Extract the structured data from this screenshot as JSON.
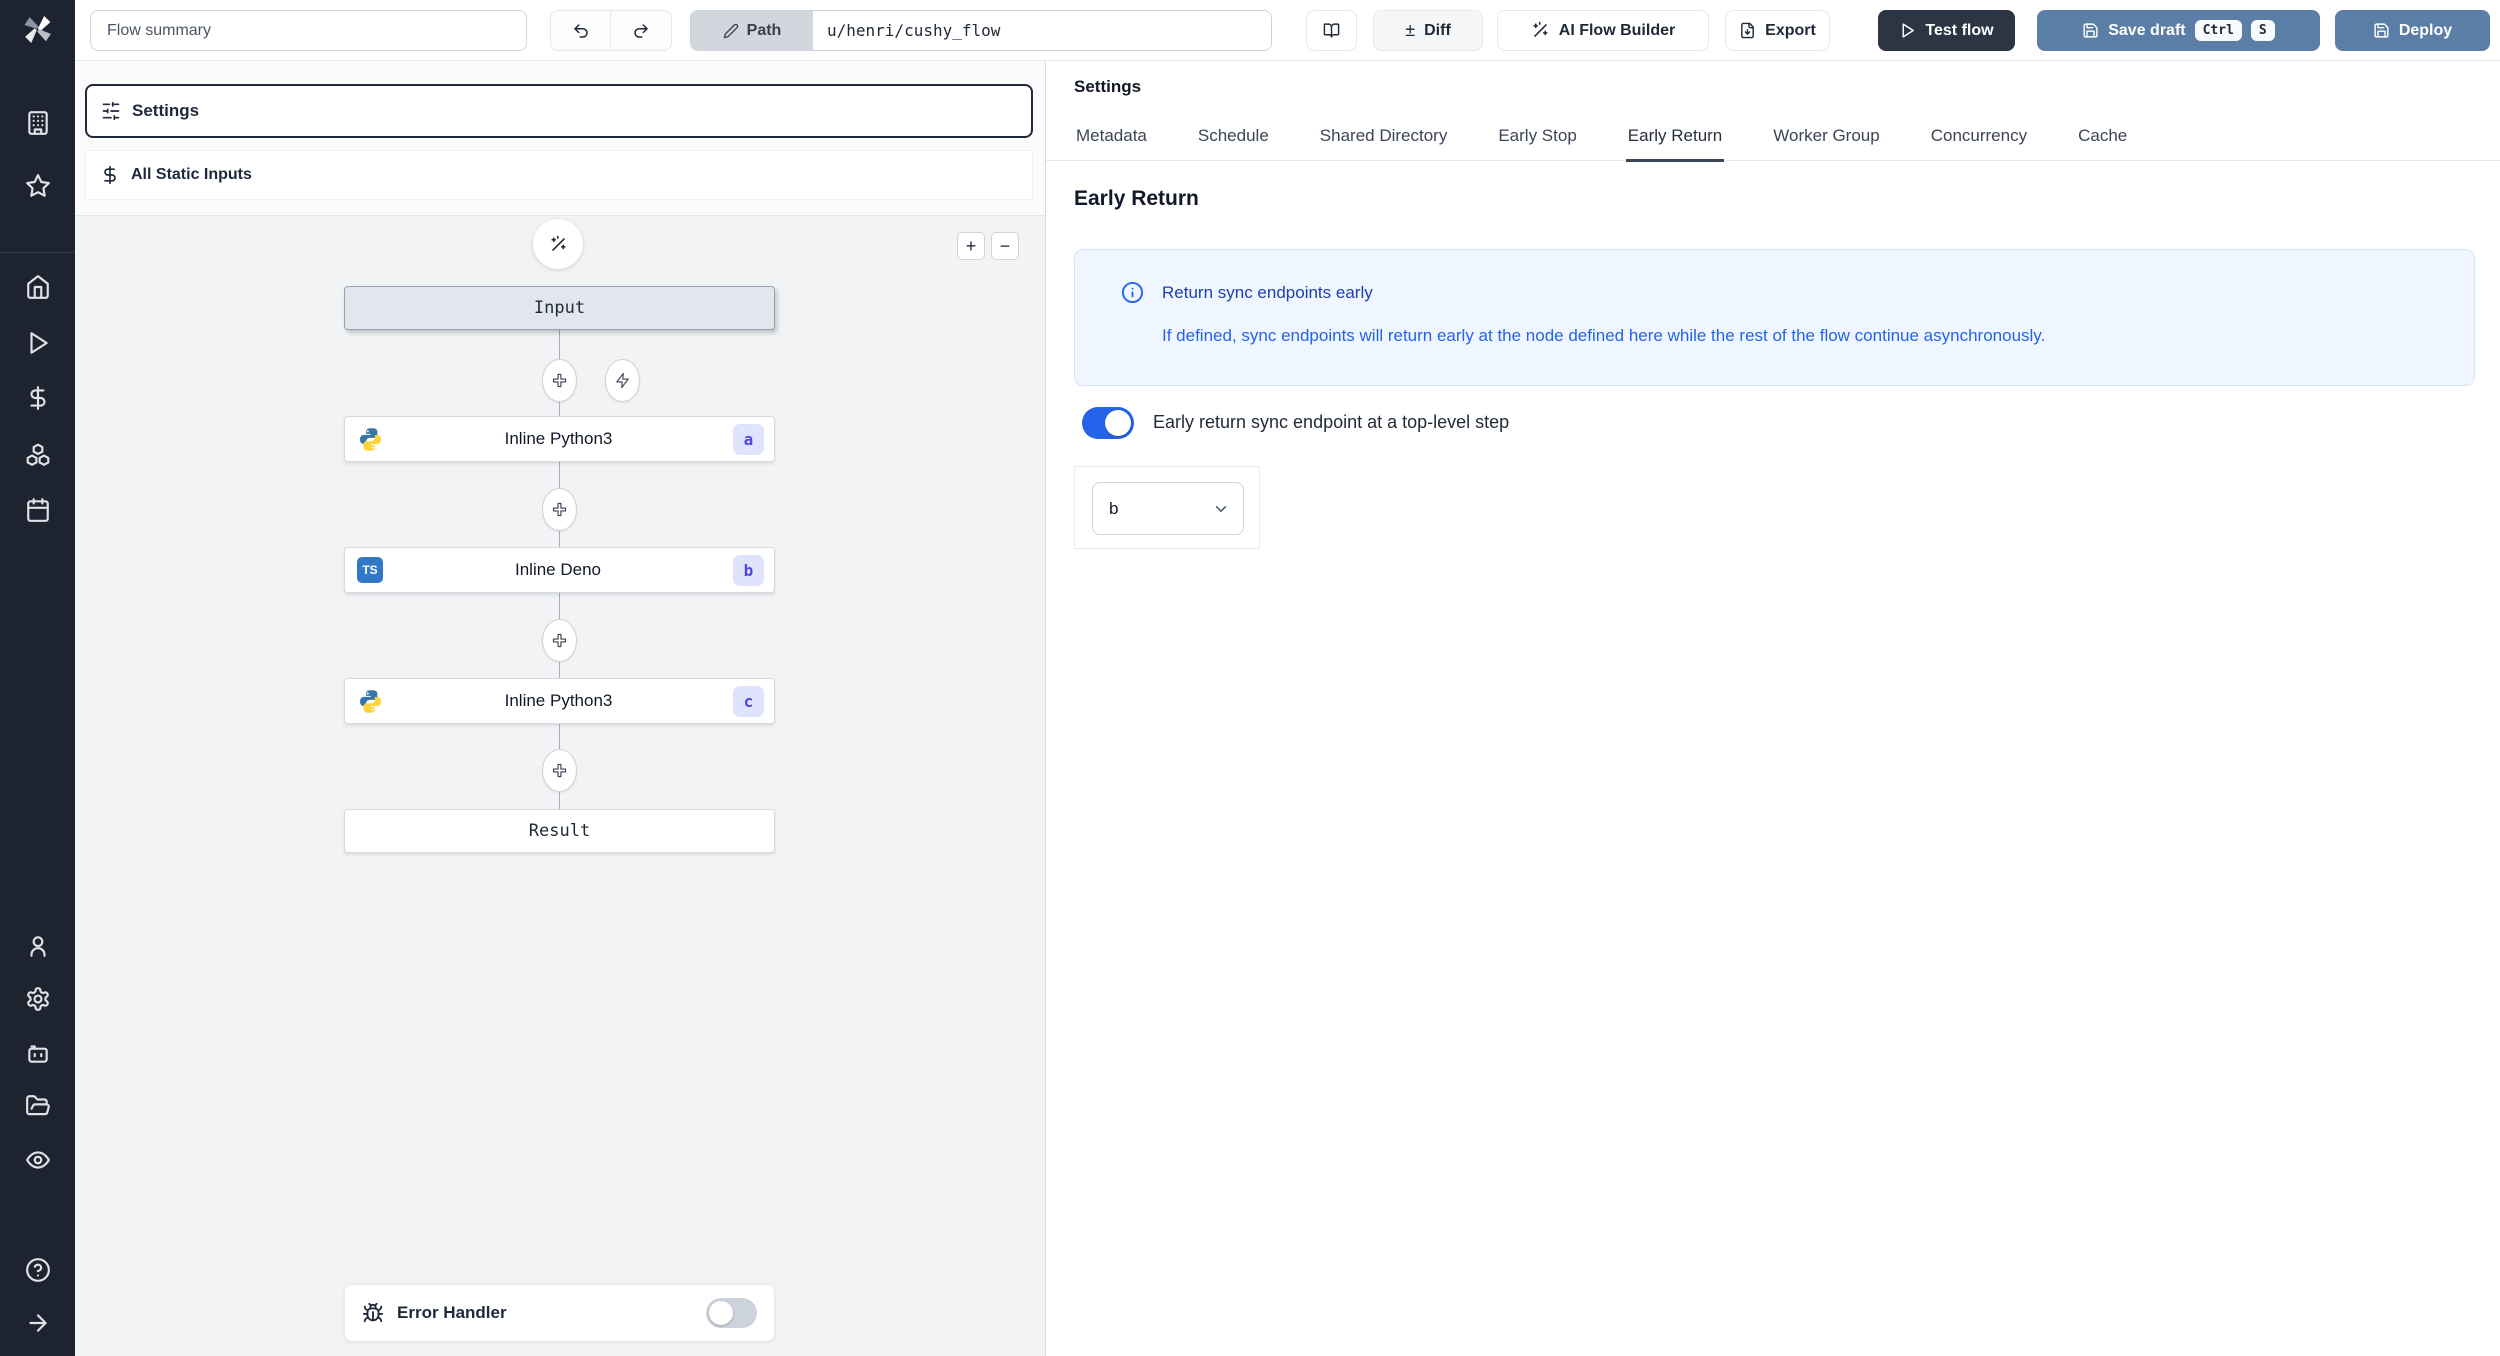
{
  "app": {
    "name": "Windmill flow editor"
  },
  "topbar": {
    "summary_placeholder": "Flow summary",
    "path_label": "Path",
    "path_value": "u/henri/cushy_flow",
    "diff_label": "Diff",
    "ai_builder_label": "AI Flow Builder",
    "export_label": "Export",
    "test_flow_label": "Test flow",
    "save_draft_label": "Save draft",
    "save_shortcut_mod": "Ctrl",
    "save_shortcut_key": "S",
    "deploy_label": "Deploy"
  },
  "glyphs": {
    "plus": "+",
    "minus": "−",
    "plus_minus": "±",
    "ts_logo": "TS"
  },
  "flow_panel": {
    "settings_label": "Settings",
    "static_inputs_label": "All Static Inputs",
    "error_handler_label": "Error Handler",
    "error_handler_enabled": false,
    "nodes": [
      {
        "label": "Input",
        "type": "input"
      },
      {
        "label": "Inline Python3",
        "badge": "a",
        "lang": "python"
      },
      {
        "label": "Inline Deno",
        "badge": "b",
        "lang": "typescript"
      },
      {
        "label": "Inline Python3",
        "badge": "c",
        "lang": "python"
      },
      {
        "label": "Result",
        "type": "result"
      }
    ]
  },
  "settings_panel": {
    "title": "Settings",
    "tabs": [
      {
        "label": "Metadata",
        "active": false
      },
      {
        "label": "Schedule",
        "active": false
      },
      {
        "label": "Shared Directory",
        "active": false
      },
      {
        "label": "Early Stop",
        "active": false
      },
      {
        "label": "Early Return",
        "active": true
      },
      {
        "label": "Worker Group",
        "active": false
      },
      {
        "label": "Concurrency",
        "active": false
      },
      {
        "label": "Cache",
        "active": false
      }
    ],
    "section_title": "Early Return",
    "info": {
      "title": "Return sync endpoints early",
      "body": "If defined, sync endpoints will return early at the node defined here while the rest of the flow continue asynchronously."
    },
    "toggle_label": "Early return sync endpoint at a top-level step",
    "toggle_on": true,
    "select_value": "b"
  },
  "colors": {
    "sidebar_bg": "#1e2330",
    "accent_blue": "#2563eb",
    "steel_button": "#5b7ea6",
    "dark_button": "#2b3544",
    "info_bg": "#eff6ff",
    "info_title": "#1e40af",
    "info_body": "#2563eb",
    "badge_bg": "#dfe4fc",
    "badge_text": "#4f46e5",
    "graph_bg": "#f1f3f5"
  }
}
